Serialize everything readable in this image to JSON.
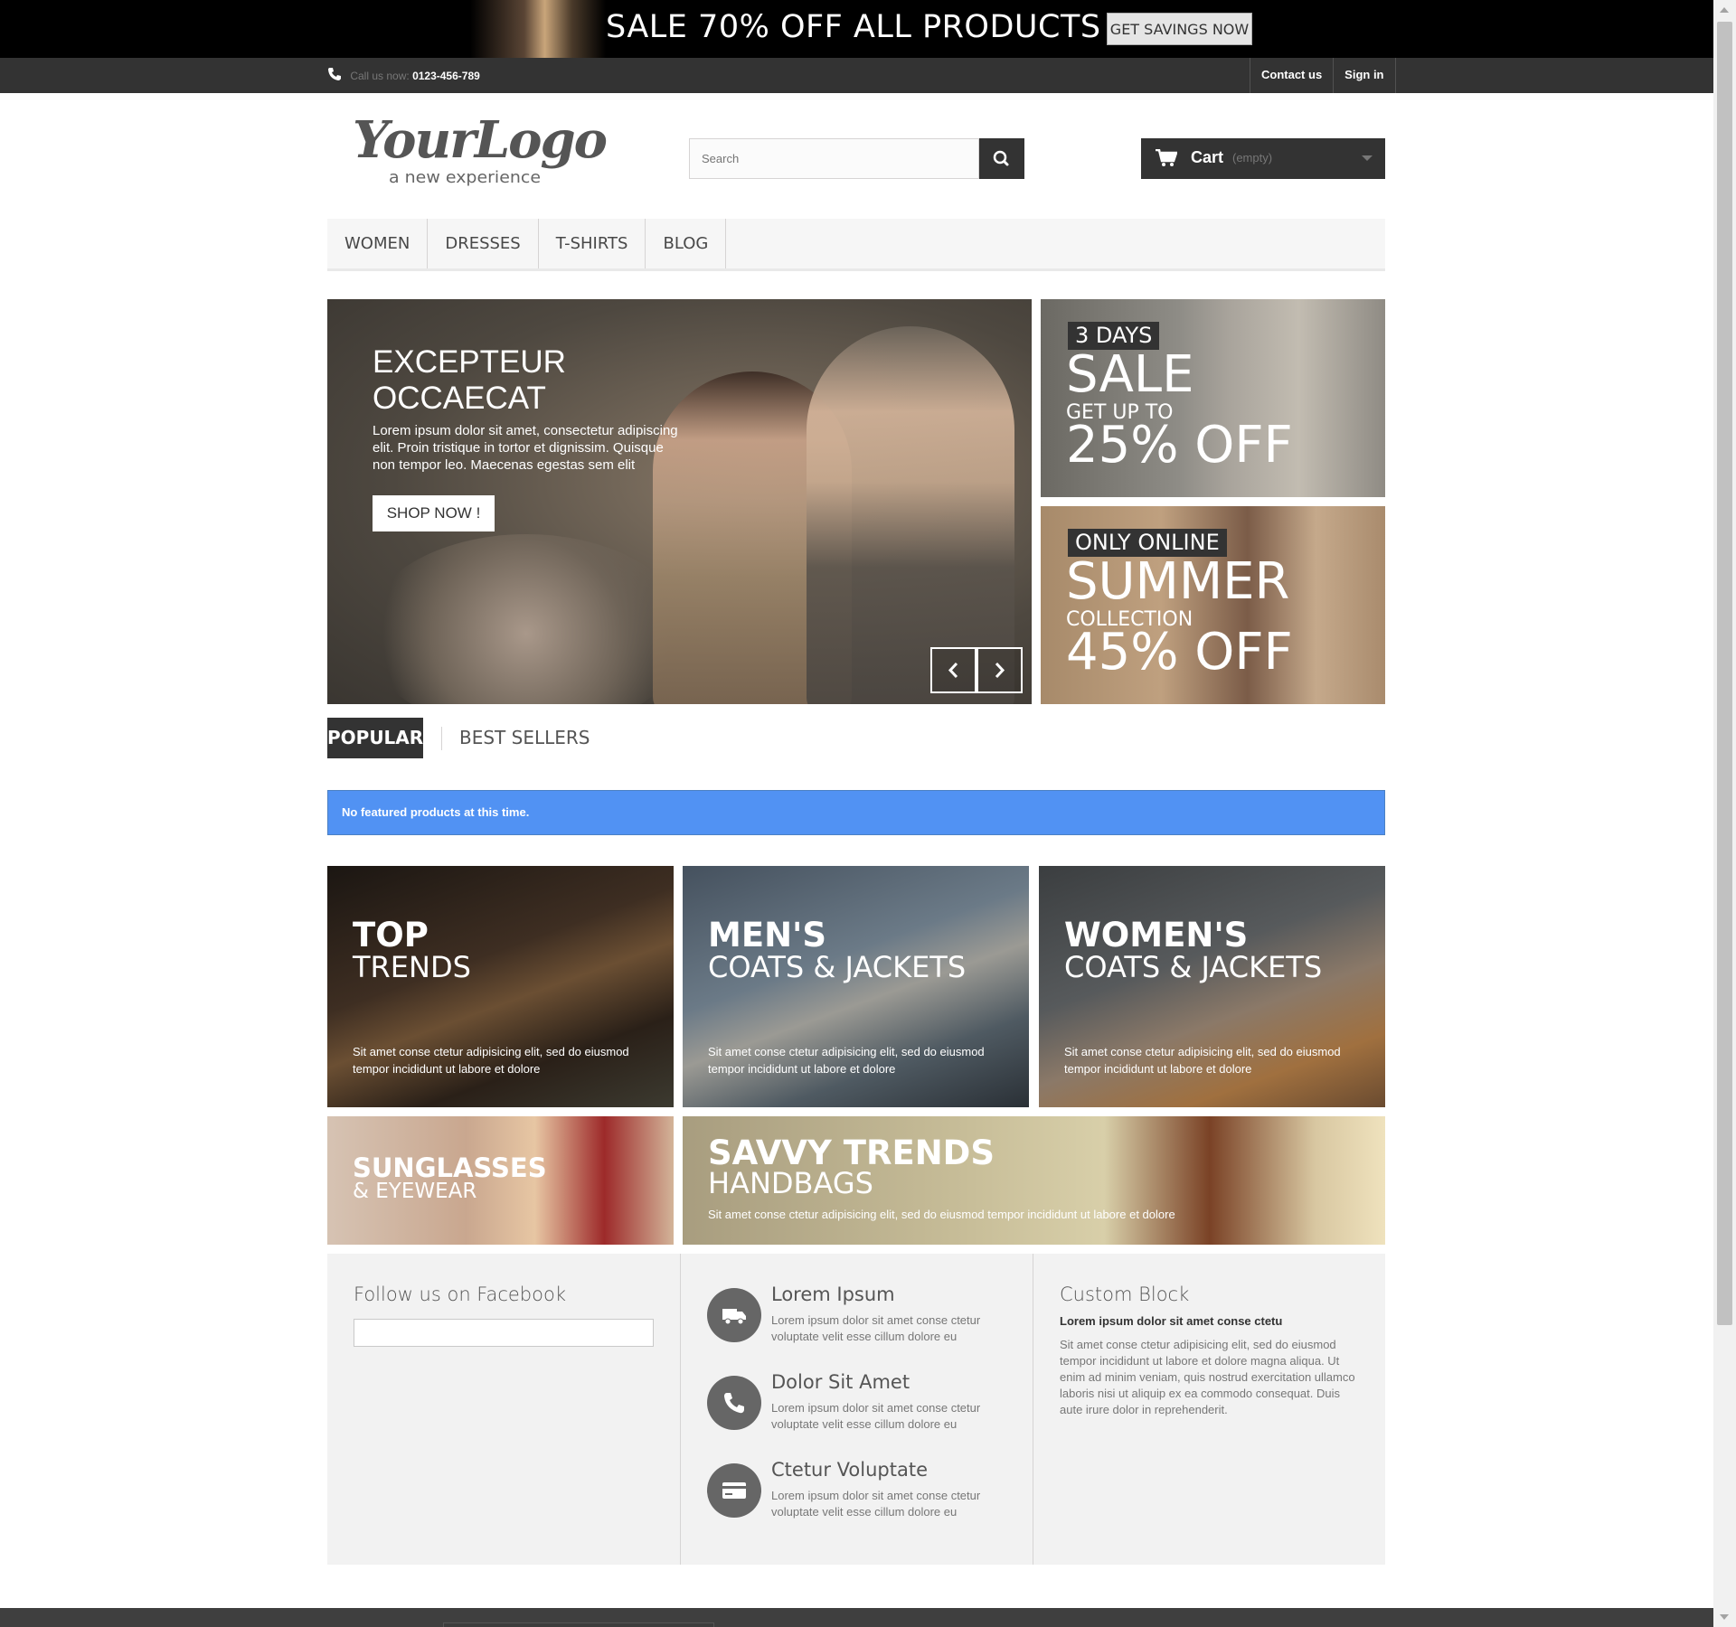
{
  "promo": {
    "text": "SALE 70% OFF ALL PRODUCTS",
    "button": "GET SAVINGS NOW"
  },
  "topbar": {
    "call_label": "Call us now:",
    "phone": "0123-456-789",
    "links": [
      "Contact us",
      "Sign in"
    ]
  },
  "header": {
    "logo": {
      "main": "YourLogo",
      "tagline": "a new experience"
    },
    "search_placeholder": "Search",
    "cart": {
      "label": "Cart",
      "status": "(empty)"
    }
  },
  "menu": [
    "WOMEN",
    "DRESSES",
    "T-SHIRTS",
    "BLOG"
  ],
  "hero": {
    "title": "EXCEPTEUR OCCAECAT",
    "text": "Lorem ipsum dolor sit amet, consectetur adipiscing elit. Proin tristique in tortor et dignissim. Quisque non tempor leo. Maecenas egestas sem elit",
    "button": "SHOP NOW !"
  },
  "side_banners": [
    {
      "tag": "3 DAYS",
      "big": "SALE",
      "mid": "GET UP TO",
      "offer": "25% OFF"
    },
    {
      "tag": "ONLY ONLINE",
      "big": "SUMMER",
      "mid": "COLLECTION",
      "offer": "45% OFF"
    }
  ],
  "tabs": [
    "POPULAR",
    "BEST SELLERS"
  ],
  "alert": "No featured products at this time.",
  "tiles": [
    {
      "h1": "TOP",
      "h2": "TRENDS",
      "text": "Sit amet conse ctetur adipisicing elit, sed do eiusmod tempor incididunt ut labore et dolore"
    },
    {
      "h1": "MEN'S",
      "h2": "COATS & JACKETS",
      "text": "Sit amet conse ctetur adipisicing elit, sed do eiusmod tempor incididunt ut labore et dolore"
    },
    {
      "h1": "WOMEN'S",
      "h2": "COATS & JACKETS",
      "text": "Sit amet conse ctetur adipisicing elit, sed do eiusmod tempor incididunt ut labore et dolore"
    },
    {
      "h1": "SUNGLASSES",
      "h2": "& EYEWEAR"
    },
    {
      "h1": "SAVVY TRENDS",
      "h2": "HANDBAGS",
      "text": "Sit amet conse ctetur adipisicing elit, sed do eiusmod tempor incididunt ut labore et dolore"
    }
  ],
  "footer_blocks": {
    "facebook_title": "Follow us on Facebook",
    "services": [
      {
        "icon": "truck-icon",
        "title": "Lorem Ipsum",
        "text": "Lorem ipsum dolor sit amet conse ctetur voluptate velit esse cillum dolore eu"
      },
      {
        "icon": "phone-icon",
        "title": "Dolor Sit Amet",
        "text": "Lorem ipsum dolor sit amet conse ctetur voluptate velit esse cillum dolore eu"
      },
      {
        "icon": "credit-card-icon",
        "title": "Ctetur Voluptate",
        "text": "Lorem ipsum dolor sit amet conse ctetur voluptate velit esse cillum dolore eu"
      }
    ],
    "custom_block": {
      "title": "Custom Block",
      "subtitle": "Lorem ipsum dolor sit amet conse ctetu",
      "text": "Sit amet conse ctetur adipisicing elit, sed do eiusmod tempor incididunt ut labore et dolore magna aliqua. Ut enim ad minim veniam, quis nostrud exercitation ullamco laboris nisi ut aliquip ex ea commodo consequat. Duis aute irure dolor in reprehenderit."
    }
  },
  "colors": {
    "dark": "#333333",
    "alert_blue": "#5192f3",
    "block_bg": "#f2f2f2"
  }
}
